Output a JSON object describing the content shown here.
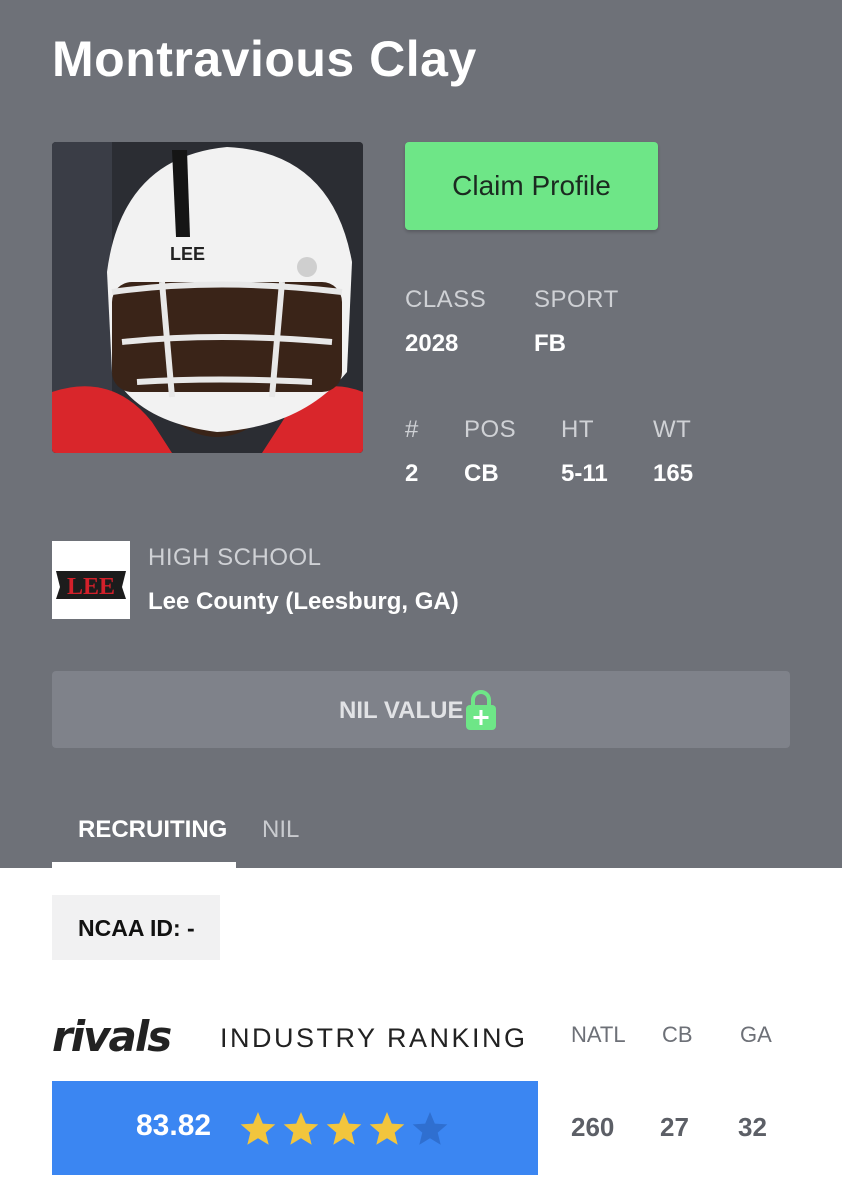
{
  "player": {
    "name": "Montravious Clay"
  },
  "actions": {
    "claim_label": "Claim Profile"
  },
  "bio": {
    "class_label": "CLASS",
    "class_value": "2028",
    "sport_label": "SPORT",
    "sport_value": "FB",
    "number_label": "#",
    "number_value": "2",
    "pos_label": "POS",
    "pos_value": "CB",
    "ht_label": "HT",
    "ht_value": "5-11",
    "wt_label": "WT",
    "wt_value": "165"
  },
  "photo": {
    "helmet_text": "LEE"
  },
  "school": {
    "label": "HIGH SCHOOL",
    "name": "Lee County (Leesburg, GA)",
    "logo_text": "LEE"
  },
  "nil": {
    "label": "NIL VALUE",
    "icon": "lock-plus-icon"
  },
  "tabs": [
    {
      "label": "RECRUITING",
      "active": true
    },
    {
      "label": "NIL",
      "active": false
    }
  ],
  "ncaa": {
    "text": "NCAA ID:  -"
  },
  "ranking": {
    "brand": "rivals",
    "title": "INDUSTRY RANKING",
    "score": "83.82",
    "stars_filled": 4,
    "stars_total": 5,
    "columns": [
      {
        "label": "NATL",
        "value": "260"
      },
      {
        "label": "CB",
        "value": "27"
      },
      {
        "label": "GA",
        "value": "32"
      }
    ]
  },
  "colors": {
    "panel": "#6e7178",
    "claim_button": "#6ee687",
    "rating_bar": "#3b86f2",
    "star_filled": "#f2c53d",
    "star_empty": "#2f6fd0",
    "school_red": "#d3202a"
  }
}
